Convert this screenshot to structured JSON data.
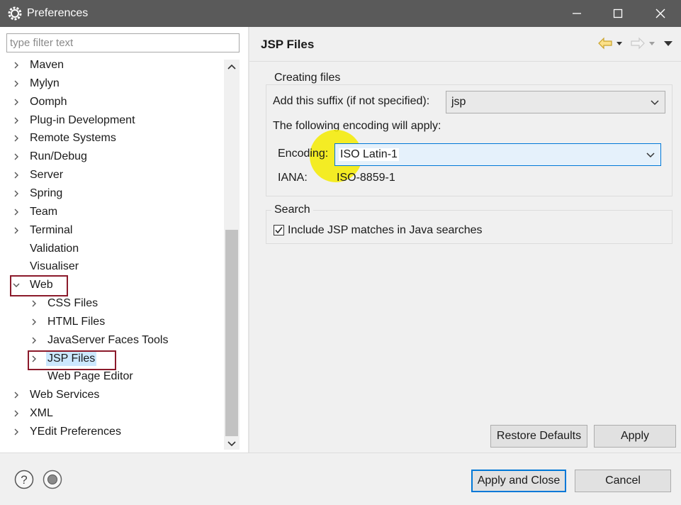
{
  "window": {
    "title": "Preferences"
  },
  "filter": {
    "placeholder": "type filter text",
    "value": ""
  },
  "tree": {
    "items": [
      {
        "label": "Maven",
        "expandable": true,
        "expanded": false,
        "level": 0
      },
      {
        "label": "Mylyn",
        "expandable": true,
        "expanded": false,
        "level": 0
      },
      {
        "label": "Oomph",
        "expandable": true,
        "expanded": false,
        "level": 0
      },
      {
        "label": "Plug-in Development",
        "expandable": true,
        "expanded": false,
        "level": 0
      },
      {
        "label": "Remote Systems",
        "expandable": true,
        "expanded": false,
        "level": 0
      },
      {
        "label": "Run/Debug",
        "expandable": true,
        "expanded": false,
        "level": 0
      },
      {
        "label": "Server",
        "expandable": true,
        "expanded": false,
        "level": 0
      },
      {
        "label": "Spring",
        "expandable": true,
        "expanded": false,
        "level": 0
      },
      {
        "label": "Team",
        "expandable": true,
        "expanded": false,
        "level": 0
      },
      {
        "label": "Terminal",
        "expandable": true,
        "expanded": false,
        "level": 0
      },
      {
        "label": "Validation",
        "expandable": false,
        "expanded": false,
        "level": 0
      },
      {
        "label": "Visualiser",
        "expandable": false,
        "expanded": false,
        "level": 0
      },
      {
        "label": "Web",
        "expandable": true,
        "expanded": true,
        "level": 0
      },
      {
        "label": "CSS Files",
        "expandable": true,
        "expanded": false,
        "level": 1
      },
      {
        "label": "HTML Files",
        "expandable": true,
        "expanded": false,
        "level": 1
      },
      {
        "label": "JavaServer Faces Tools",
        "expandable": true,
        "expanded": false,
        "level": 1
      },
      {
        "label": "JSP Files",
        "expandable": true,
        "expanded": false,
        "level": 1,
        "selected": true
      },
      {
        "label": "Web Page Editor",
        "expandable": false,
        "expanded": false,
        "level": 1
      },
      {
        "label": "Web Services",
        "expandable": true,
        "expanded": false,
        "level": 0
      },
      {
        "label": "XML",
        "expandable": true,
        "expanded": false,
        "level": 0
      },
      {
        "label": "YEdit Preferences",
        "expandable": true,
        "expanded": false,
        "level": 0
      }
    ]
  },
  "page": {
    "title": "JSP Files",
    "creating_files": {
      "group_title": "Creating files",
      "suffix_label": "Add this suffix (if not specified):",
      "suffix_value": "jsp",
      "encoding_intro": "The following encoding will apply:",
      "encoding_label": "Encoding:",
      "encoding_value": "ISO Latin-1",
      "iana_label": "IANA:",
      "iana_value": "ISO-8859-1"
    },
    "search": {
      "group_title": "Search",
      "include_label": "Include JSP matches in Java searches",
      "include_checked": true
    },
    "restore_defaults_label": "Restore Defaults",
    "apply_label": "Apply"
  },
  "footer": {
    "apply_close_label": "Apply and Close",
    "cancel_label": "Cancel"
  },
  "colors": {
    "accent": "#0078d7",
    "highlight_box": "#8b1a2b",
    "selection": "#cce8ff",
    "cursor_spot": "#f5eb00"
  }
}
